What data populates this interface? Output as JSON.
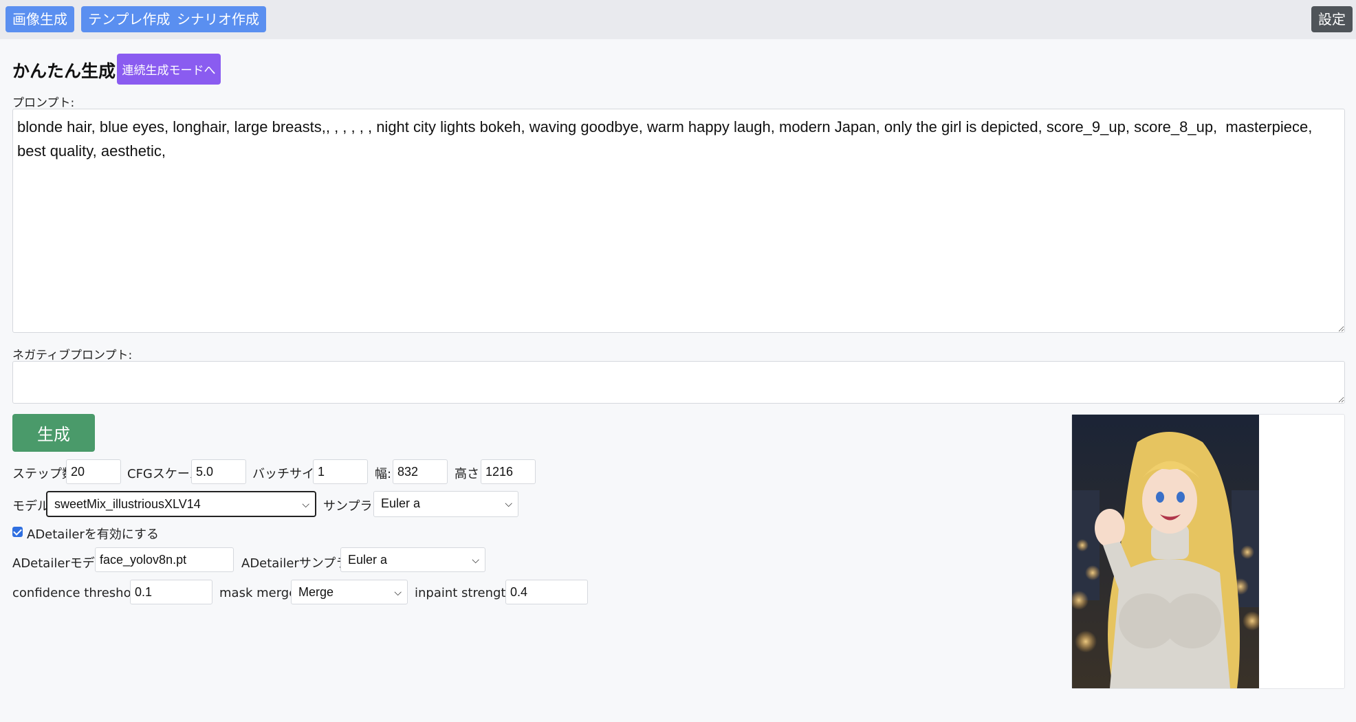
{
  "nav": {
    "tabs": [
      "画像生成",
      "テンプレ作成",
      "シナリオ作成"
    ],
    "settings_label": "設定"
  },
  "header": {
    "title": "かんたん生成",
    "mode_button": "連続生成モードへ"
  },
  "prompt": {
    "label": "プロンプト:",
    "value": "blonde hair, blue eyes, longhair, large breasts,, , , , , , night city lights bokeh, waving goodbye, warm happy laugh, modern Japan, only the girl is depicted, score_9_up, score_8_up,  masterpiece, best quality, aesthetic,"
  },
  "negative_prompt": {
    "label": "ネガティブプロンプト:",
    "value": ""
  },
  "generate_button": "生成",
  "params": {
    "steps_label": "ステップ数:",
    "steps": "20",
    "cfg_label": "CFGスケール:",
    "cfg": "5.0",
    "batch_label": "バッチサイズ:",
    "batch": "1",
    "width_label": "幅:",
    "width": "832",
    "height_label": "高さ:",
    "height": "1216"
  },
  "model": {
    "label": "モデル:",
    "value": "sweetMix_illustriousXLV14",
    "sampler_label": "サンプラー:",
    "sampler": "Euler a"
  },
  "adetailer": {
    "enable_label": "ADetailerを有効にする",
    "enabled": true,
    "model_label": "ADetailerモデル:",
    "model": "face_yolov8n.pt",
    "sampler_label": "ADetailerサンプラー:",
    "sampler": "Euler a",
    "confidence_label": "confidence threshold:",
    "confidence": "0.1",
    "mask_merge_label": "mask merge:",
    "mask_merge": "Merge",
    "inpaint_label": "inpaint strength:",
    "inpaint": "0.4"
  },
  "colors": {
    "nav_button": "#5a8ff0",
    "settings_button": "#4f5459",
    "mode_button": "#8a5cf0",
    "generate_button": "#4a9a6a"
  }
}
